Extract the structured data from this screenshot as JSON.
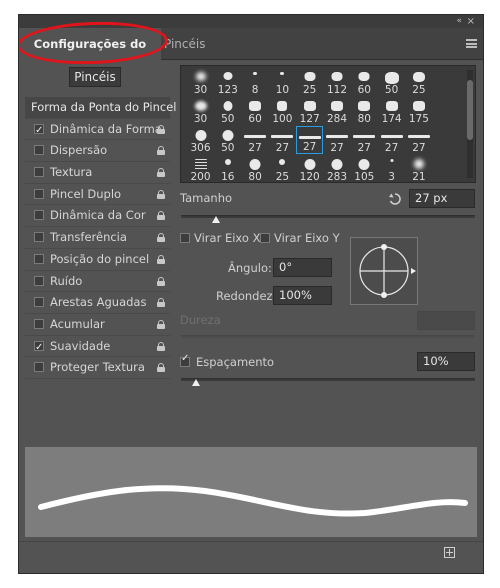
{
  "tabs": [
    {
      "label": "Configurações do pincel",
      "active": true
    },
    {
      "label": "Pincéis",
      "active": false
    }
  ],
  "header_icons": {
    "collapse": "«",
    "close": "×",
    "menu": "menu-icon"
  },
  "brushes_button": "Pincéis",
  "left_list": {
    "head": "Forma da Ponta do Pincel",
    "items": [
      {
        "label": "Dinâmica da Forma",
        "checked": true
      },
      {
        "label": "Dispersão",
        "checked": false
      },
      {
        "label": "Textura",
        "checked": false
      },
      {
        "label": "Pincel Duplo",
        "checked": false
      },
      {
        "label": "Dinâmica da Cor",
        "checked": false
      },
      {
        "label": "Transferência",
        "checked": false
      },
      {
        "label": "Posição do pincel",
        "checked": false
      },
      {
        "label": "Ruído",
        "checked": false
      },
      {
        "label": "Arestas Aguadas",
        "checked": false
      },
      {
        "label": "Acumular",
        "checked": false
      },
      {
        "label": "Suavidade",
        "checked": true
      },
      {
        "label": "Proteger Textura",
        "checked": false
      }
    ]
  },
  "presets": {
    "rows": [
      [
        "30",
        "123",
        "8",
        "10",
        "25",
        "112",
        "60",
        "50",
        "25"
      ],
      [
        "30",
        "50",
        "60",
        "100",
        "127",
        "284",
        "80",
        "174",
        "175"
      ],
      [
        "306",
        "50",
        "27",
        "27",
        "27",
        "27",
        "27",
        "27",
        "27"
      ],
      [
        "200",
        "16",
        "80",
        "25",
        "120",
        "283",
        "105",
        "3",
        "21"
      ]
    ],
    "selected": "27"
  },
  "size": {
    "label": "Tamanho",
    "value": "27 px",
    "fraction": 0.12
  },
  "flip_x": {
    "label": "Virar Eixo X",
    "checked": false
  },
  "flip_y": {
    "label": "Virar Eixo Y",
    "checked": false
  },
  "angle": {
    "label": "Ângulo:",
    "value": "0°"
  },
  "roundness": {
    "label": "Redondez:",
    "value": "100%"
  },
  "hardness": {
    "label": "Dureza"
  },
  "spacing": {
    "label": "Espaçamento",
    "value": "10%",
    "checked": true,
    "fraction": 0.05
  },
  "colors": {
    "panel": "#535353",
    "field": "#3a3a3a",
    "highlight": "#e0141b",
    "selection": "#2d9be0"
  }
}
